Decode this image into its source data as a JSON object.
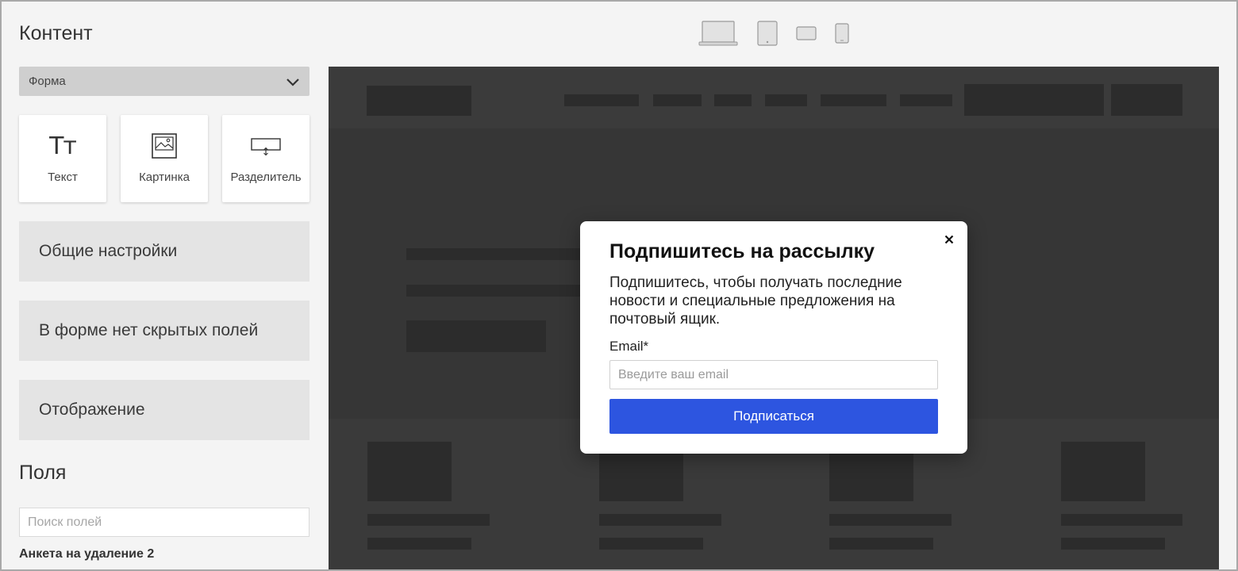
{
  "panel": {
    "title": "Контент",
    "form_select": "Форма",
    "tiles": [
      {
        "label": "Текст",
        "icon": "text-icon",
        "glyph": "Тт"
      },
      {
        "label": "Картинка",
        "icon": "image-icon"
      },
      {
        "label": "Разделитель",
        "icon": "divider-icon"
      }
    ],
    "sections": [
      "Общие настройки",
      "В форме нет скрытых полей",
      "Отображение"
    ],
    "fields_title": "Поля",
    "fields_search_placeholder": "Поиск полей",
    "field_group": "Анкета на удаление 2"
  },
  "devices": [
    "laptop-icon",
    "tablet-icon",
    "tablet-landscape-icon",
    "phone-icon"
  ],
  "modal": {
    "title": "Подпишитесь на рассылку",
    "description": "Подпишитесь, чтобы получать последние новости и специальные предложения на почтовый ящик.",
    "email_label": "Email*",
    "email_placeholder": "Введите ваш email",
    "submit_label": "Подписаться"
  },
  "colors": {
    "accent": "#2d55e0",
    "preview_bg": "#3a3a3a",
    "section_bg": "#e4e4e4",
    "select_bg": "#cfcfcf"
  }
}
